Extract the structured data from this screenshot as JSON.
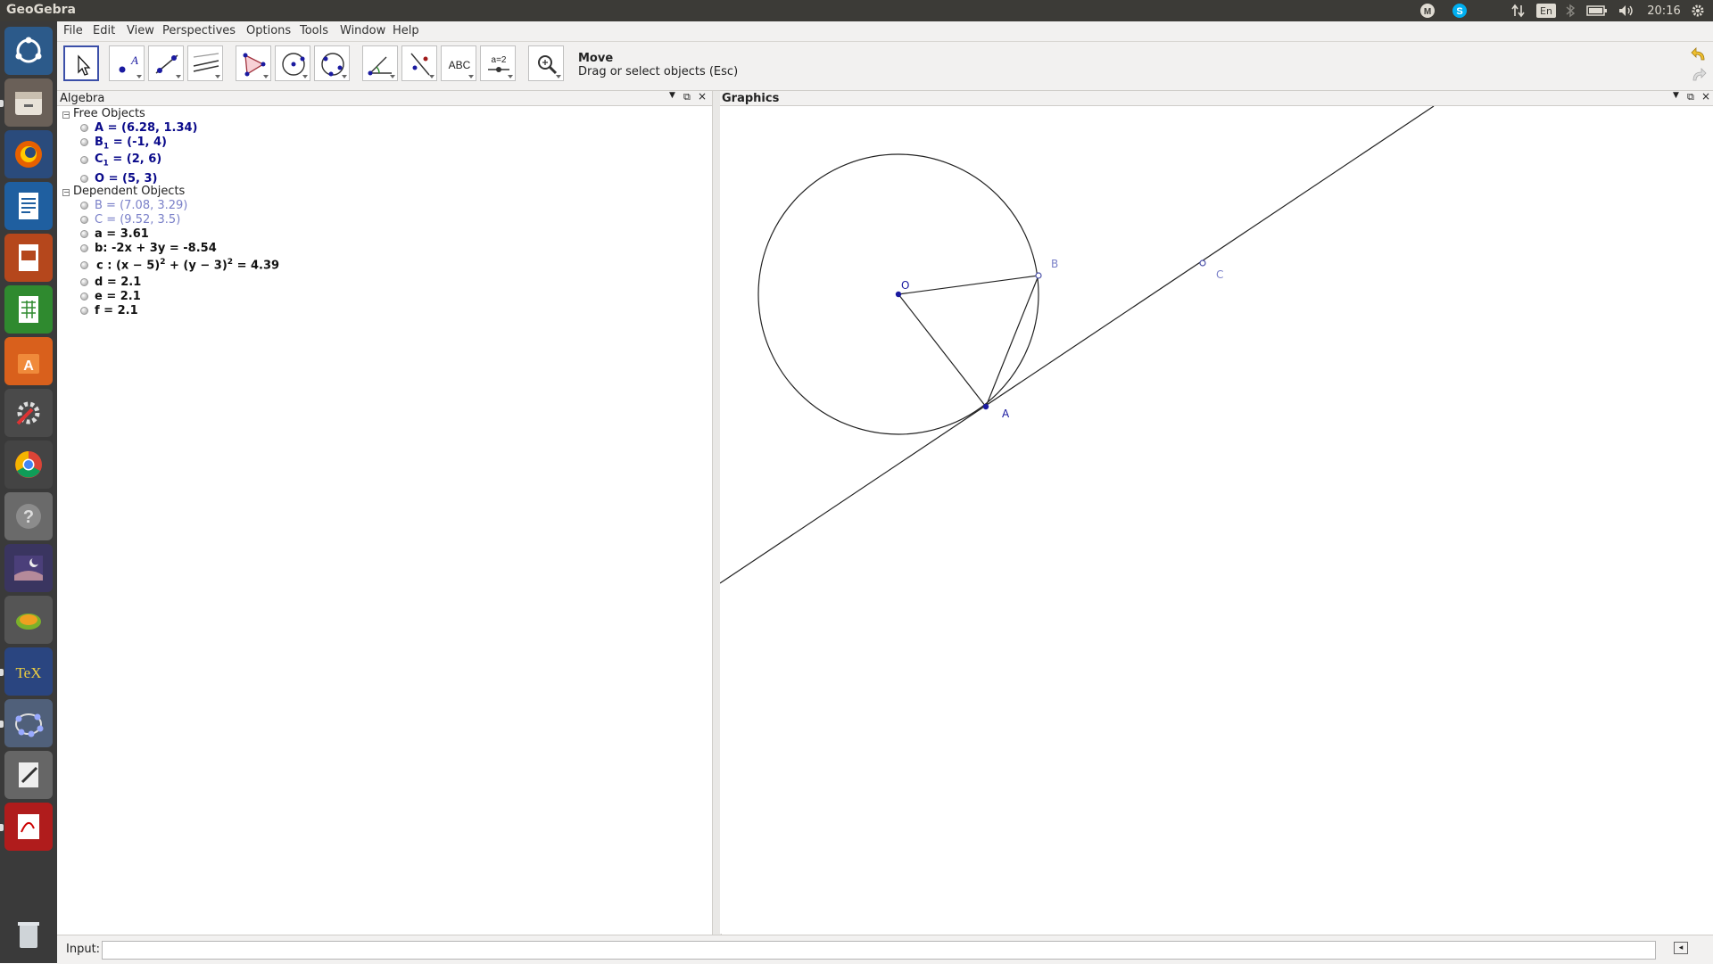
{
  "topbar": {
    "app_title": "GeoGebra",
    "keyboard_layout": "En",
    "clock": "20:16"
  },
  "menu": [
    "File",
    "Edit",
    "View",
    "Perspectives",
    "Options",
    "Tools",
    "Window",
    "Help"
  ],
  "toolbar": {
    "tool_name": "Move",
    "tool_help": "Drag or select objects (Esc)",
    "text_tool_label": "ABC",
    "slider_tool_label": "a=2"
  },
  "algebra": {
    "title": "Algebra",
    "free_header": "Free Objects",
    "free": [
      {
        "name": "A",
        "rest": " = (6.28, 1.34)"
      },
      {
        "name": "B",
        "sub": "1",
        "rest": " = (-1, 4)"
      },
      {
        "name": "C",
        "sub": "1",
        "rest": " = (2, 6)"
      },
      {
        "name": "O",
        "rest": " = (5, 3)"
      }
    ],
    "dependent_header": "Dependent Objects",
    "dependent": [
      {
        "text": "B = (7.08, 3.29)"
      },
      {
        "text": "C = (9.52, 3.5)"
      },
      {
        "text": "a = 3.61"
      },
      {
        "text": "b: -2x + 3y = -8.54"
      },
      {
        "c_prefix": "c : (x − 5)",
        "c_sup1": "2",
        "c_mid": " + (y − 3)",
        "c_sup2": "2",
        "c_end": " = 4.39"
      },
      {
        "text": "d = 2.1"
      },
      {
        "text": "e = 2.1"
      },
      {
        "text": "f = 2.1"
      }
    ]
  },
  "graphics": {
    "title": "Graphics",
    "labels": {
      "O": "O",
      "B": "B",
      "C": "C",
      "A": "A"
    }
  },
  "input": {
    "label": "Input:",
    "value": ""
  },
  "colors": {
    "free_object": "#0a0a8a",
    "dependent_object": "#7a80c8",
    "point_fill": "#1a1aa0"
  }
}
